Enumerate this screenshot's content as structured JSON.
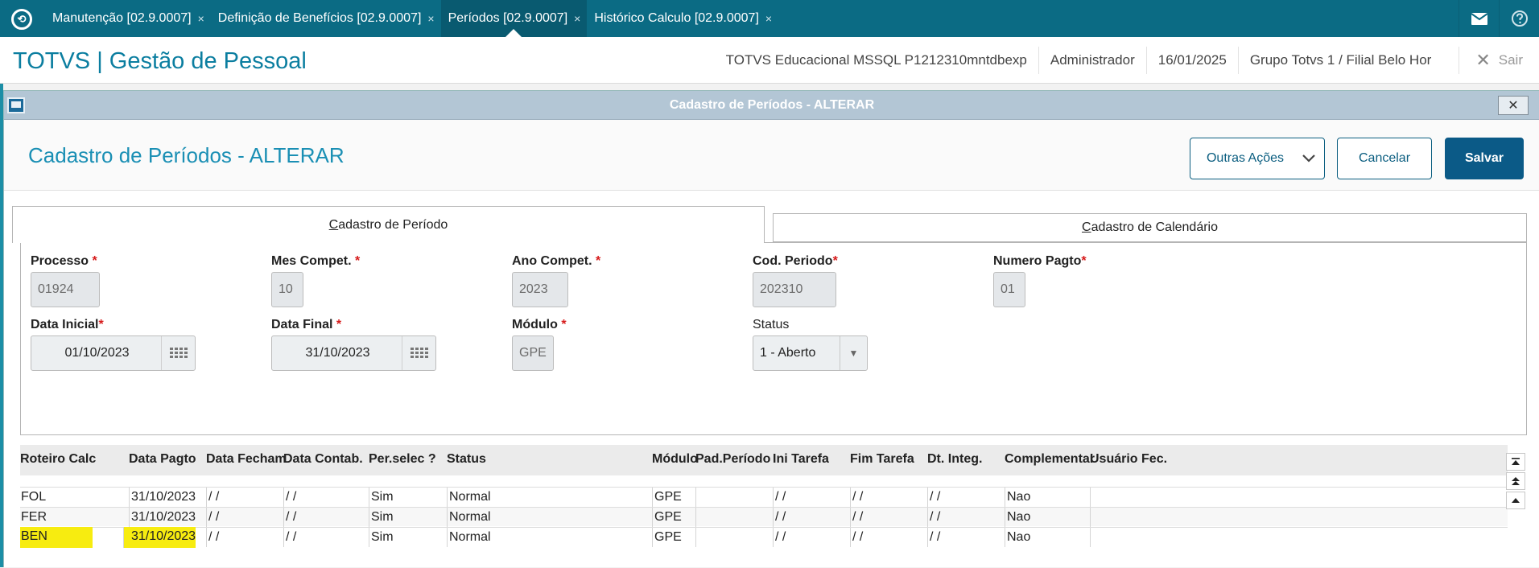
{
  "topbar": {
    "tabs": [
      {
        "label": "Manutenção [02.9.0007]"
      },
      {
        "label": "Definição de Benefícios [02.9.0007]"
      },
      {
        "label": "Períodos [02.9.0007]"
      },
      {
        "label": "Histórico Calculo [02.9.0007]"
      }
    ],
    "close_glyph": "×",
    "icons": [
      "mail-icon",
      "help-icon"
    ]
  },
  "header": {
    "app_title": "TOTVS | Gestão de Pessoal",
    "environment": "TOTVS Educacional MSSQL P1212310mntdbexp",
    "user": "Administrador",
    "date": "16/01/2025",
    "company": "Grupo Totvs 1 / Filial Belo Hor",
    "exit_label": "Sair"
  },
  "dialog": {
    "titlebar": "Cadastro de Períodos - ALTERAR",
    "page_title": "Cadastro de Períodos - ALTERAR",
    "buttons": {
      "outras": "Outras Ações",
      "cancelar": "Cancelar",
      "salvar": "Salvar"
    },
    "tabs": [
      {
        "first": "C",
        "rest": "adastro de Período"
      },
      {
        "first": "C",
        "rest": "adastro de Calendário"
      }
    ]
  },
  "form": {
    "processo": {
      "label": "Processo",
      "value": "01924"
    },
    "mes": {
      "label": "Mes Compet.",
      "value": "10"
    },
    "ano": {
      "label": "Ano Compet.",
      "value": "2023"
    },
    "cod": {
      "label": "Cod. Periodo",
      "value": "202310"
    },
    "numero": {
      "label": "Numero Pagto",
      "value": "01"
    },
    "data_inicial": {
      "label": "Data Inicial",
      "value": "01/10/2023"
    },
    "data_final": {
      "label": "Data Final",
      "value": "31/10/2023"
    },
    "modulo": {
      "label": "Módulo",
      "value": "GPE"
    },
    "status": {
      "label": "Status",
      "value": "1 - Aberto"
    },
    "required_mark": "*"
  },
  "grid": {
    "columns": [
      "Roteiro Calc",
      "Data Pagto",
      "Data Fecham",
      "Data Contab.",
      "Per.selec ?",
      "Status",
      "Módulo",
      "Pad.Período",
      "Ini Tarefa",
      "Fim Tarefa",
      "Dt. Integ.",
      "Complementar",
      "Usuário Fec."
    ],
    "rows": [
      [
        "FOL",
        "31/10/2023",
        " /  /",
        " /  /",
        "Sim",
        "Normal",
        "GPE",
        "",
        " /  /",
        " /  /",
        " /  /",
        "Nao",
        ""
      ],
      [
        "FER",
        "31/10/2023",
        " /  /",
        " /  /",
        "Sim",
        "Normal",
        "GPE",
        "",
        " /  /",
        " /  /",
        " /  /",
        "Nao",
        ""
      ],
      [
        "BEN",
        "31/10/2023",
        " /  /",
        " /  /",
        "Sim",
        "Normal",
        "GPE",
        "",
        " /  /",
        " /  /",
        " /  /",
        "Nao",
        ""
      ]
    ],
    "highlight_color": "#f7ec10"
  }
}
